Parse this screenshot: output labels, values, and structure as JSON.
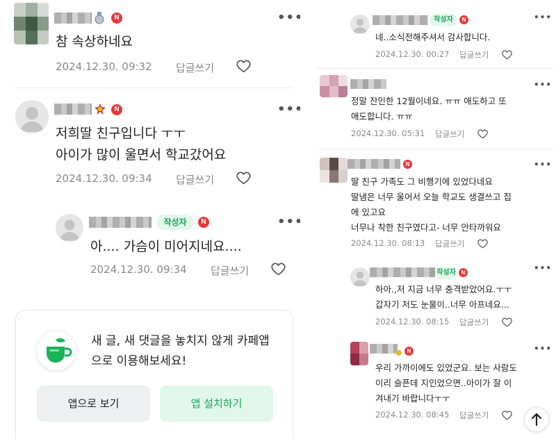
{
  "left": {
    "comments": [
      {
        "text": "참 속상하네요",
        "date": "2024.12.30. 09:32",
        "reply": "답글쓰기"
      },
      {
        "text": "저희딸 친구입니다 ㅜㅜ\n아이가 많이 울면서 학교갔어요",
        "date": "2024.12.30. 09:34",
        "reply": "답글쓰기"
      },
      {
        "author_tag": "작성자",
        "text": "아.... 가슴이 미어지네요....",
        "date": "2024.12.30. 09:34",
        "reply": "답글쓰기"
      }
    ],
    "promo": {
      "message": "새 글, 새 댓글을 놓치지 않게 카페앱으로 이용해보세요!",
      "open_app_label": "앱으로 보기",
      "install_label": "앱 설치하기"
    }
  },
  "right": {
    "comments": [
      {
        "author_tag": "작성자",
        "text": "네..소식전해주셔서 감사합니다.",
        "date": "2024.12.30. 00:27",
        "reply": "답글쓰기"
      },
      {
        "text": "정말 잔인한 12월이네요. ㅠㅠ 애도하고 또\n애도합니다. ㅠㅠ",
        "date": "2024.12.30. 05:31",
        "reply": "답글쓰기"
      },
      {
        "text": "딸 친구 가족도 그 비행기에 있었다네요\n딸냄은 너무 울어서 오늘 학교도 생결쓰고 집\n에 있고요\n너무나 착한 친구였다고- 너무 안타까워요",
        "date": "2024.12.30. 08:13",
        "reply": "답글쓰기"
      },
      {
        "author_tag": "작성자",
        "text": "하아.,저 지금 너무 충격받았어요.ㅜㅜ\n갑자기 저도 눈물이..너무 아프네요...",
        "date": "2024.12.30. 08:15",
        "reply": "답글쓰기"
      },
      {
        "text": "우리 가까이에도 있었군요. 보는 사람도\n이리 슬픈데 지인었으면..아이가 잘 이\n겨내기 바랍니다ㅜㅜ",
        "date": "2024.12.30. 08:45",
        "reply": "답글쓰기"
      }
    ]
  },
  "badge_letter": "N",
  "icons": {
    "more": "more-icon",
    "heart": "heart-icon",
    "profile": "profile-icon",
    "cup": "cafe-cup-icon",
    "arrow": "arrow-up-icon"
  },
  "colors": {
    "accent_green": "#19b35a",
    "badge_red": "#e5383b",
    "meta_gray": "#888888"
  }
}
